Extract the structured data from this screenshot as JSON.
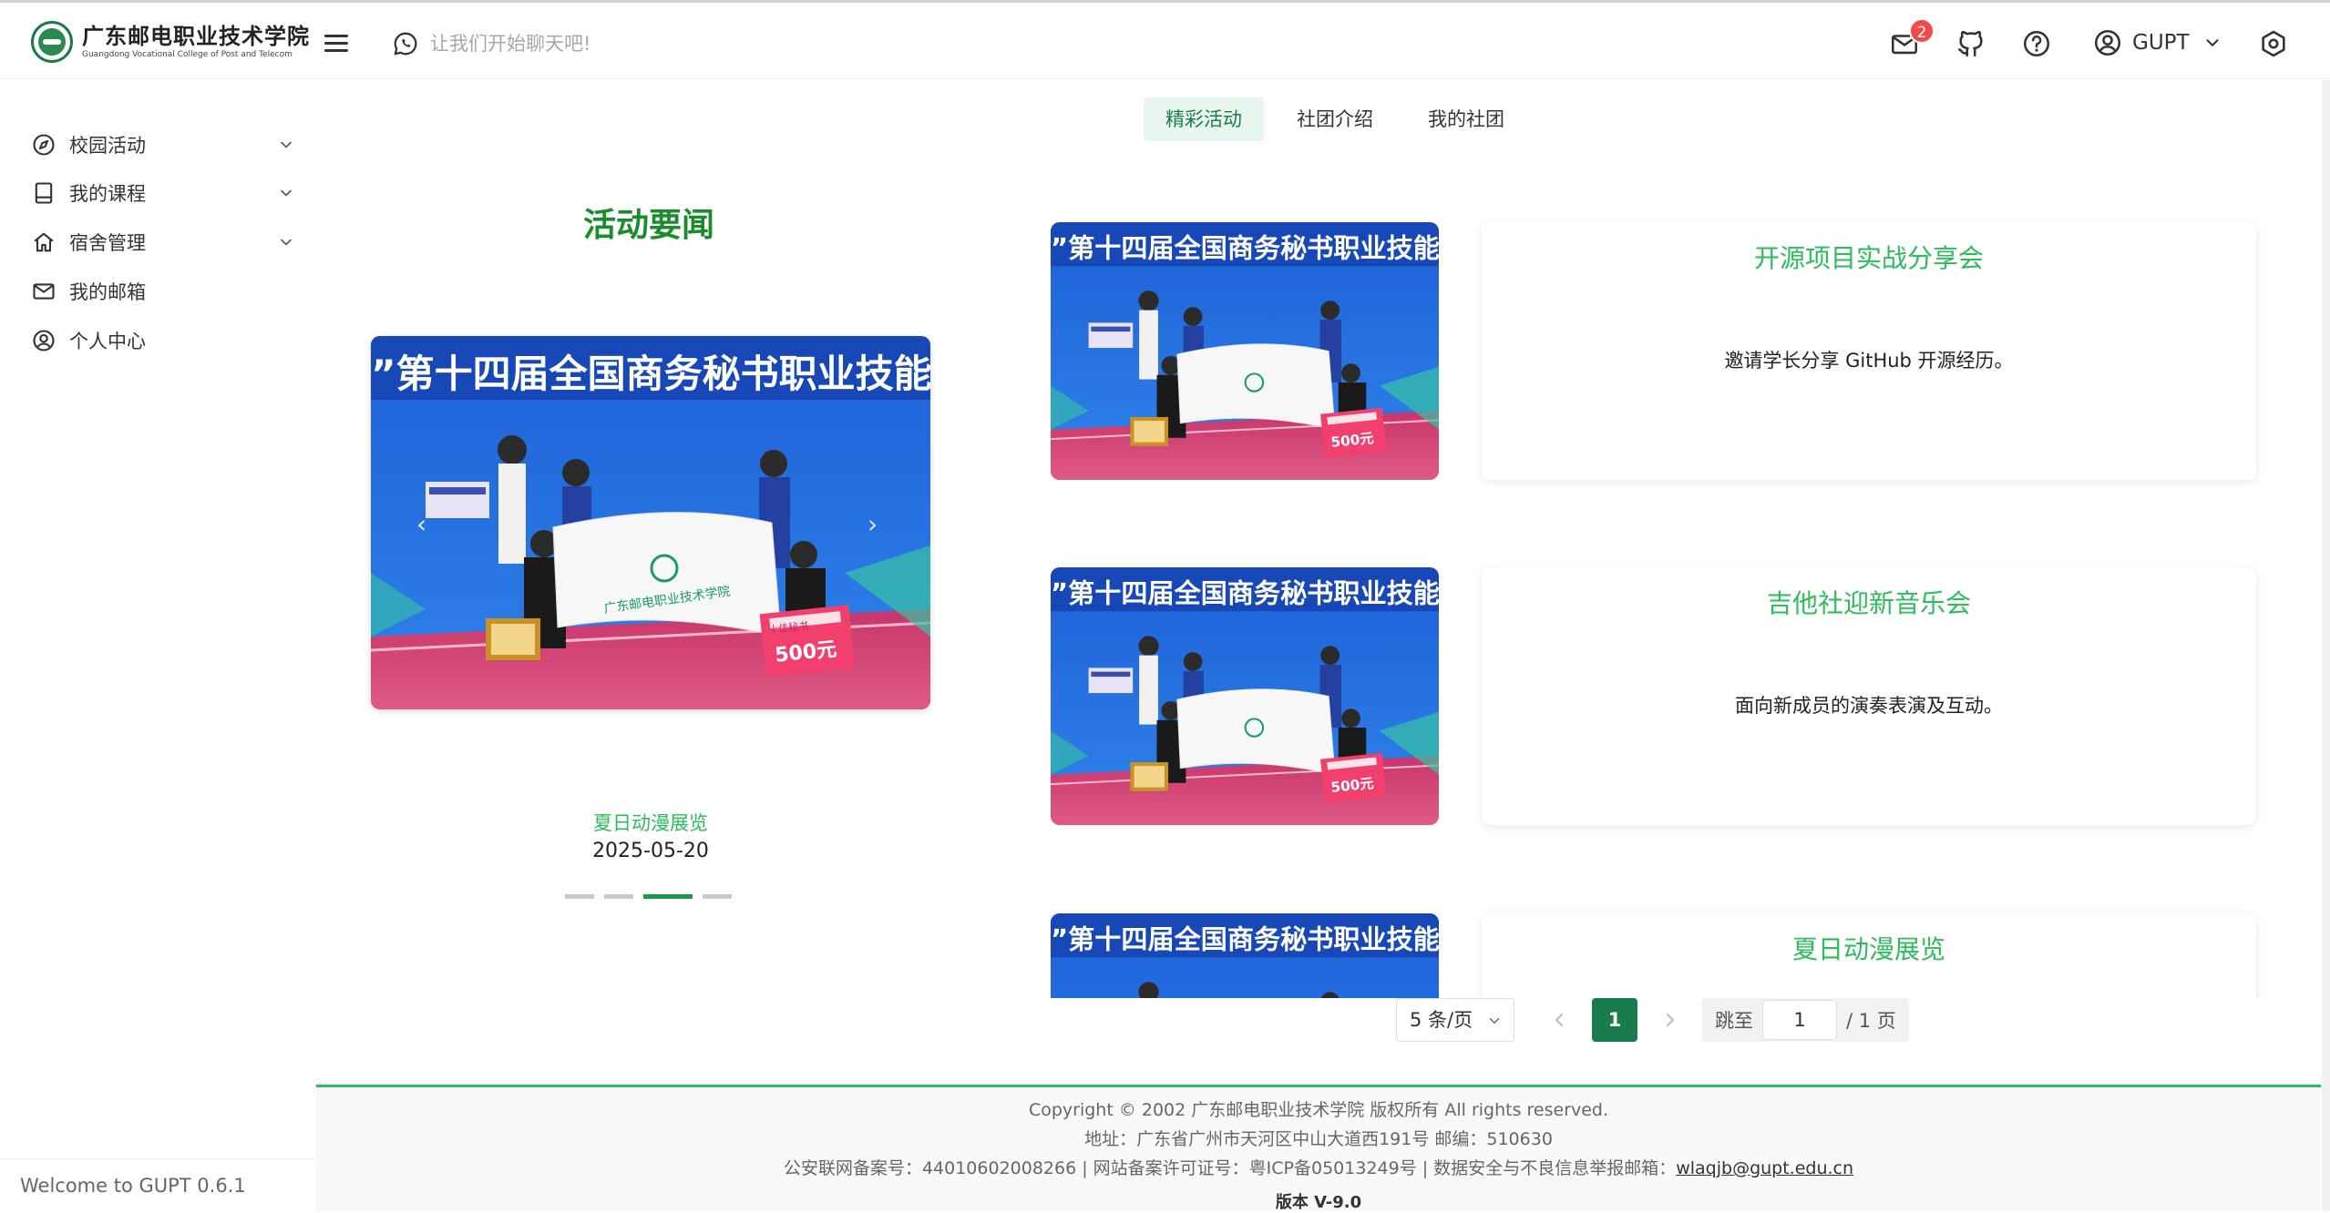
{
  "header": {
    "logo_cn": "广东邮电职业技术学院",
    "logo_en": "Guangdong Vocational College of Post and Telecom",
    "chat_placeholder": "让我们开始聊天吧!",
    "mail_badge": "2",
    "user_name": "GUPT",
    "icons": [
      "menu-icon",
      "chat-icon",
      "mail-icon",
      "github-icon",
      "help-icon",
      "user-circle-icon",
      "chevron-down-icon",
      "settings-icon"
    ]
  },
  "sidebar": {
    "items": [
      {
        "label": "校园活动",
        "icon": "compass-icon",
        "expandable": true
      },
      {
        "label": "我的课程",
        "icon": "book-icon",
        "expandable": true
      },
      {
        "label": "宿舍管理",
        "icon": "home-icon",
        "expandable": true
      },
      {
        "label": "我的邮箱",
        "icon": "mail-icon",
        "expandable": false
      },
      {
        "label": "个人中心",
        "icon": "user-circle-icon",
        "expandable": false
      }
    ],
    "footer": "Welcome to GUPT 0.6.1"
  },
  "tabs": [
    {
      "label": "精彩活动",
      "active": true
    },
    {
      "label": "社团介绍",
      "active": false
    },
    {
      "label": "我的社团",
      "active": false
    }
  ],
  "news": {
    "title": "活动要闻",
    "slide_title": "夏日动漫展览",
    "slide_date": "2025-05-20",
    "slide_count": 4,
    "active_slide": 3,
    "photo_banner": "”第十四届全国商务秘书职业技能",
    "flag_text": "广东邮电职业技术学院",
    "cheque_amount": "500元",
    "cheque_header": "十佳秘书"
  },
  "activities": [
    {
      "title": "开源项目实战分享会",
      "desc": "邀请学长分享 GitHub 开源经历。"
    },
    {
      "title": "吉他社迎新音乐会",
      "desc": "面向新成员的演奏表演及互动。"
    },
    {
      "title": "夏日动漫展览",
      "desc": ""
    }
  ],
  "pagination": {
    "page_size": "5 条/页",
    "current_page": "1",
    "jump_label": "跳至",
    "jump_value": "1",
    "total_label": "/ 1 页"
  },
  "footer": {
    "copyright": "Copyright © 2002 广东邮电职业技术学院 版权所有 All rights reserved.",
    "address": "地址：广东省广州市天河区中山大道西191号  邮编：510630",
    "record_prefix": "公安联网备案号：44010602008266 | 网站备案许可证号：粤ICP备05013249号 | 数据安全与不良信息举报邮箱：",
    "email": "wlaqjb@gupt.edu.cn",
    "version": "版本 V-9.0"
  },
  "colors": {
    "brand_green": "#1a7b4d",
    "accent_green": "#2bbd5a",
    "badge_red": "#f5484a"
  }
}
